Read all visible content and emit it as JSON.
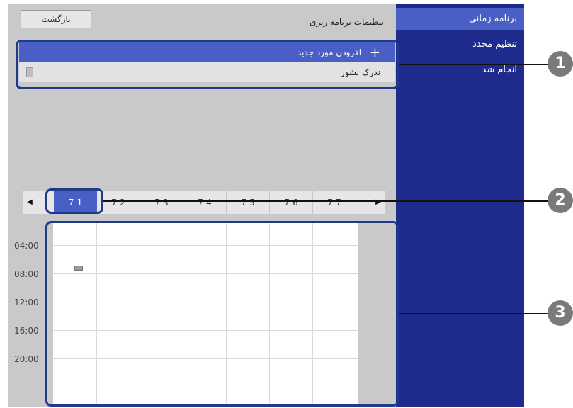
{
  "back_button": "بازگشت",
  "page_title": "تنظیمات برنامه ریزی",
  "sidebar": {
    "items": [
      {
        "label": "برنامه زمانی",
        "active": true
      },
      {
        "label": "تنظیم مجدد",
        "active": false
      },
      {
        "label": "انجام شد",
        "active": false
      }
    ]
  },
  "list": {
    "add_label": "افزودن مورد جدید",
    "add_icon": "+",
    "item_label": "ندرک نشور"
  },
  "tabs": {
    "left_arrow": "◀",
    "right_arrow": "▶",
    "items": [
      "7-1",
      "7-2",
      "7-3",
      "7-4",
      "7-5",
      "7-6",
      "7-7"
    ],
    "active": "7-1"
  },
  "time_labels": [
    "04:00",
    "08:00",
    "12:00",
    "16:00",
    "20:00"
  ],
  "callouts": [
    "1",
    "2",
    "3"
  ],
  "colors": {
    "accent": "#4a5fc6",
    "sidebar": "#1e2a8c",
    "background": "#c9c9c9",
    "callout_border": "#1e3a8a"
  }
}
